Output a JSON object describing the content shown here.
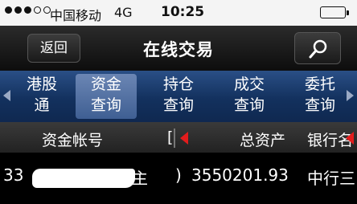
{
  "status_bar": {
    "carrier": "中国移动",
    "network": "4G",
    "time": "10:25"
  },
  "titlebar": {
    "back_label": "返回",
    "title": "在线交易"
  },
  "tabs": [
    {
      "line1": "港股",
      "line2": "通",
      "active": false
    },
    {
      "line1": "资金",
      "line2": "查询",
      "active": true
    },
    {
      "line1": "持仓",
      "line2": "查询",
      "active": false
    },
    {
      "line1": "成交",
      "line2": "查询",
      "active": false
    },
    {
      "line1": "委托",
      "line2": "查询",
      "active": false
    }
  ],
  "table": {
    "headers": {
      "account": "资金帐号",
      "currency_partial": "[",
      "total_assets": "总资产",
      "bank": "银行名"
    },
    "rows": [
      {
        "account_prefix": "33",
        "account_suffix": "主",
        "paren": ")",
        "total_assets": "3550201.93",
        "bank": "中行三"
      }
    ]
  }
}
